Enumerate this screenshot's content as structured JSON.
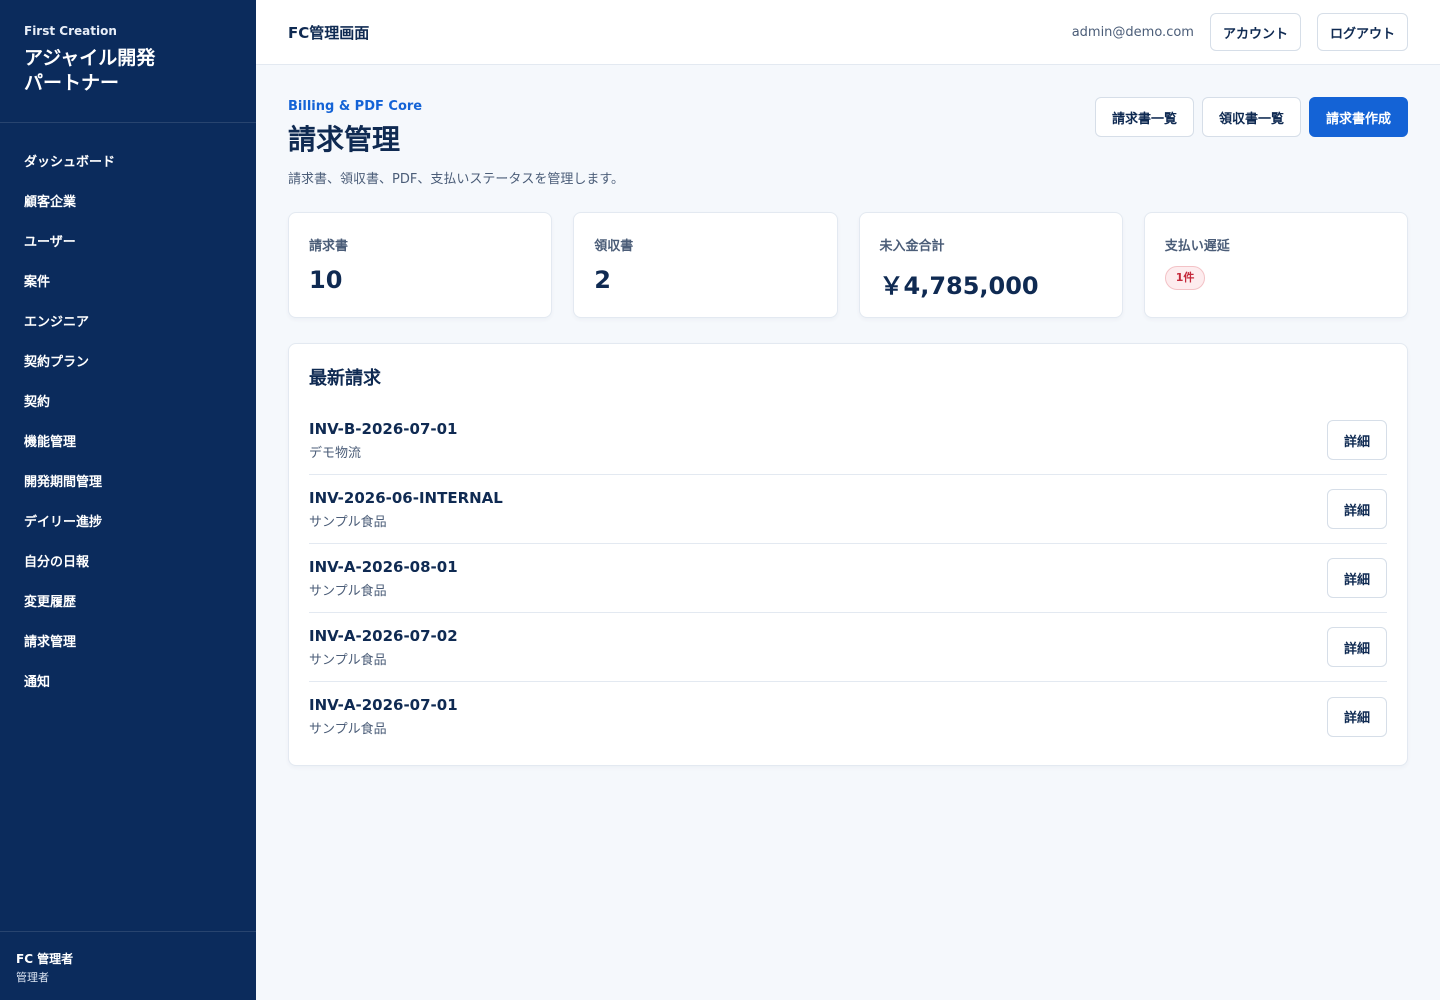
{
  "sidebar": {
    "company": "First Creation",
    "product": "アジャイル開発\nパートナー",
    "items": [
      {
        "label": "ダッシュボード"
      },
      {
        "label": "顧客企業"
      },
      {
        "label": "ユーザー"
      },
      {
        "label": "案件"
      },
      {
        "label": "エンジニア"
      },
      {
        "label": "契約プラン"
      },
      {
        "label": "契約"
      },
      {
        "label": "機能管理"
      },
      {
        "label": "開発期間管理"
      },
      {
        "label": "デイリー進捗"
      },
      {
        "label": "自分の日報"
      },
      {
        "label": "変更履歴"
      },
      {
        "label": "請求管理"
      },
      {
        "label": "通知"
      }
    ],
    "user": {
      "name": "FC 管理者",
      "role": "管理者"
    }
  },
  "topbar": {
    "title": "FC管理画面",
    "email": "admin@demo.com",
    "account_label": "アカウント",
    "logout_label": "ログアウト"
  },
  "page": {
    "eyebrow": "Billing & PDF Core",
    "title": "請求管理",
    "subtitle": "請求書、領収書、PDF、支払いステータスを管理します。",
    "actions": {
      "invoice_list": "請求書一覧",
      "receipt_list": "領収書一覧",
      "create_invoice": "請求書作成"
    }
  },
  "stats": {
    "invoices": {
      "label": "請求書",
      "value": "10"
    },
    "receipts": {
      "label": "領収書",
      "value": "2"
    },
    "unpaid_total": {
      "label": "未入金合計",
      "value": "￥4,785,000"
    },
    "overdue": {
      "label": "支払い遅延",
      "badge": "1件"
    }
  },
  "latest": {
    "title": "最新請求",
    "detail_label": "詳細",
    "rows": [
      {
        "id": "INV-B-2026-07-01",
        "client": "デモ物流"
      },
      {
        "id": "INV-2026-06-INTERNAL",
        "client": "サンプル食品"
      },
      {
        "id": "INV-A-2026-08-01",
        "client": "サンプル食品"
      },
      {
        "id": "INV-A-2026-07-02",
        "client": "サンプル食品"
      },
      {
        "id": "INV-A-2026-07-01",
        "client": "サンプル食品"
      }
    ]
  },
  "colors": {
    "sidebar_bg": "#0b2b5c",
    "primary": "#1463d6",
    "danger": "#c4283a"
  }
}
